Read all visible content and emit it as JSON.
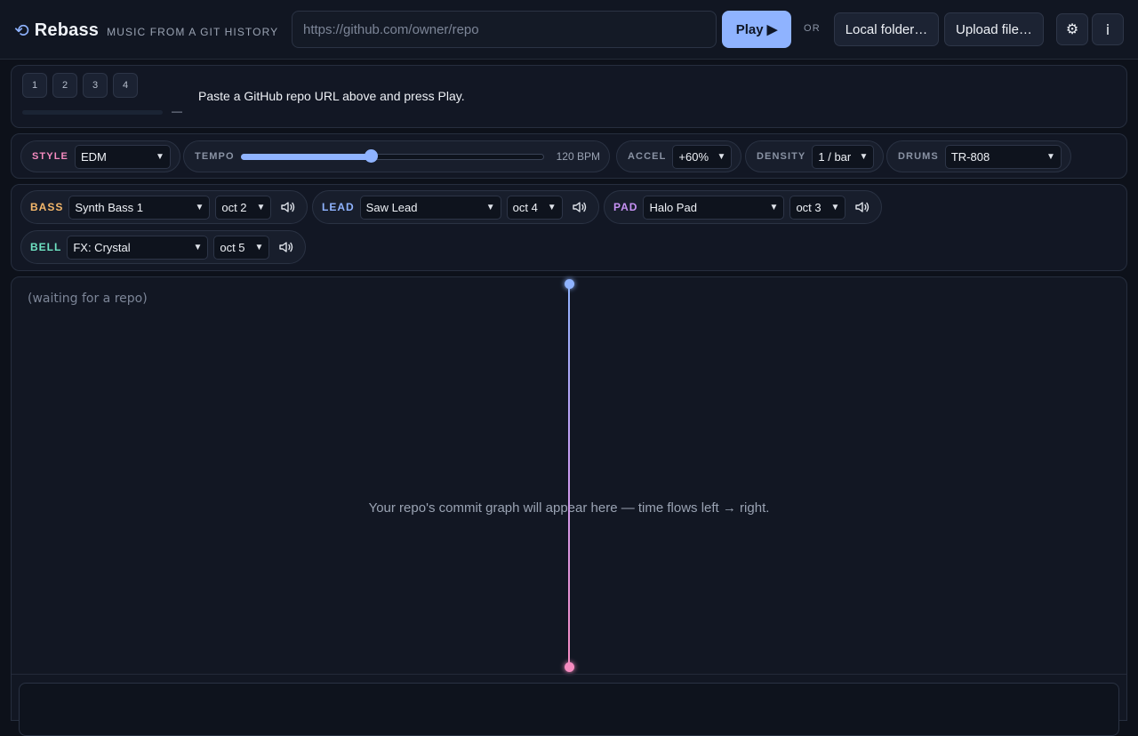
{
  "header": {
    "logo_glyph": "⟲",
    "app_name": "Rebass",
    "tagline": "MUSIC FROM A GIT HISTORY",
    "url_placeholder": "https://github.com/owner/repo",
    "play_label": "Play ▶",
    "or_label": "OR",
    "local_folder_label": "Local folder…",
    "upload_file_label": "Upload file…",
    "settings_glyph": "⚙",
    "info_glyph": "i"
  },
  "status": {
    "slots": [
      "1",
      "2",
      "3",
      "4"
    ],
    "progress_fraction": 0,
    "progress_text": "—",
    "message": "Paste a GitHub repo URL above and press Play."
  },
  "controls": {
    "style": {
      "label": "STYLE",
      "value": "EDM",
      "color": "#f58bc0"
    },
    "tempo": {
      "label": "TEMPO",
      "bpm_text": "120 BPM",
      "fraction": 0.43
    },
    "accel": {
      "label": "ACCEL",
      "value": "+60%"
    },
    "density": {
      "label": "DENSITY",
      "value": "1 / bar"
    },
    "drums": {
      "label": "DRUMS",
      "value": "TR-808"
    }
  },
  "instruments": [
    {
      "label": "BASS",
      "color": "#f5b86b",
      "sound": "Synth Bass 1",
      "octave": "oct 2",
      "icon": "speaker-icon"
    },
    {
      "label": "LEAD",
      "color": "#8fb3ff",
      "sound": "Saw Lead",
      "octave": "oct 4",
      "icon": "speaker-icon"
    },
    {
      "label": "PAD",
      "color": "#c792f5",
      "sound": "Halo Pad",
      "octave": "oct 3",
      "icon": "speaker-icon"
    },
    {
      "label": "BELL",
      "color": "#6fe3c3",
      "sound": "FX: Crystal",
      "octave": "oct 5",
      "icon": "speaker-icon"
    }
  ],
  "graph": {
    "waiting_text": "(waiting for a repo)",
    "hint": "Your repo's commit graph will appear here — time flows left → right."
  }
}
